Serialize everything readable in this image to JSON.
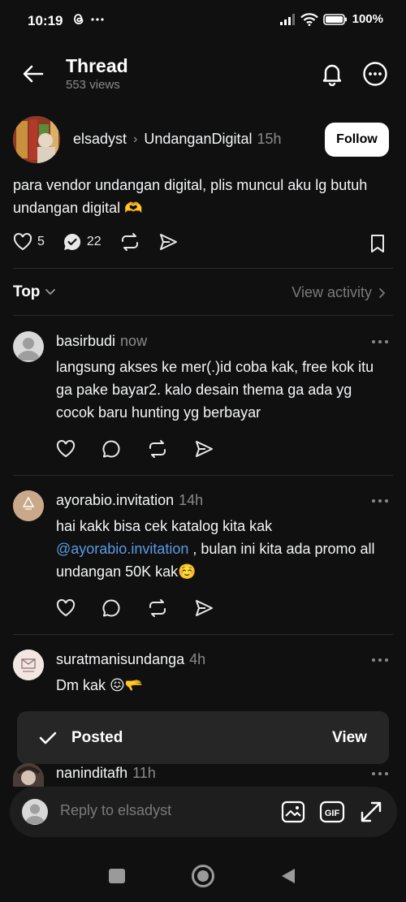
{
  "status_bar": {
    "time": "10:19",
    "battery": "100%"
  },
  "header": {
    "title": "Thread",
    "views": "553 views"
  },
  "post": {
    "username": "elsadyst",
    "community": "UndanganDigital",
    "time": "15h",
    "follow_label": "Follow",
    "text": "para vendor undangan digital, plis muncul aku lg butuh undangan digital 🫶",
    "likes": "5",
    "reposts": "22"
  },
  "sort": {
    "label": "Top",
    "view_activity": "View activity"
  },
  "replies": [
    {
      "username": "basirbudi",
      "time": "now",
      "text": "langsung akses ke mer(.)id coba kak, free kok itu ga pake bayar2. kalo desain thema ga ada yg cocok baru hunting yg berbayar"
    },
    {
      "username": "ayorabio.invitation",
      "time": "14h",
      "text_before": "hai kakk bisa cek katalog kita kak ",
      "mention": "@ayorabio.invitation",
      "text_after": " , bulan ini kita ada promo all undangan 50K kak☺️"
    },
    {
      "username": "suratmanisundanga",
      "time": "4h",
      "text": "Dm kak 😖🫳"
    },
    {
      "username": "naninditafh",
      "time": "11h"
    }
  ],
  "toast": {
    "label": "Posted",
    "action": "View"
  },
  "reply_bar": {
    "placeholder": "Reply to elsadyst"
  },
  "colors": {
    "background": "#101010",
    "mention": "#5a9be5",
    "muted": "#8a8a8a"
  }
}
